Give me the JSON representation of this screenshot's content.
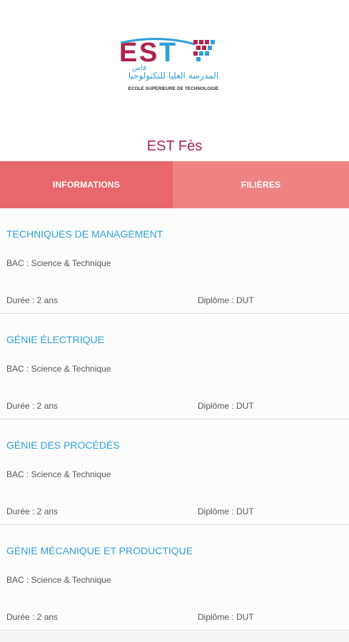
{
  "app": {
    "title": "EST Fès"
  },
  "logo": {
    "brand": "EST",
    "arabic": "المدرسة العليا للتكنولوجيا",
    "subtitle": "ECOLE SUPERIEURE DE TECHNOLOGIE",
    "city_arabic": "فاس",
    "colors": {
      "primary": "#b0224a",
      "accent": "#2e9fd8"
    }
  },
  "tabs": [
    {
      "label": "INFORMATIONS"
    },
    {
      "label": "FILIÈRES"
    }
  ],
  "filieres": [
    {
      "title": "TECHNIQUES DE MANAGEMENT",
      "bac": "BAC : Science & Technique",
      "duree": "Durée : 2 ans",
      "diplome": "Diplôme : DUT"
    },
    {
      "title": "GÉNIE ÉLECTRIQUE",
      "bac": "BAC : Science & Technique",
      "duree": "Durée : 2 ans",
      "diplome": "Diplôme : DUT"
    },
    {
      "title": "GÉNIE DES PROCÉDÉS",
      "bac": "BAC : Science & Technique",
      "duree": "Durée : 2 ans",
      "diplome": "Diplôme : DUT"
    },
    {
      "title": "GÉNIE MÉCANIQUE ET PRODUCTIQUE",
      "bac": "BAC : Science & Technique",
      "duree": "Durée : 2 ans",
      "diplome": "Diplôme : DUT"
    }
  ],
  "colors": {
    "tab_active": "#e8676a",
    "tab_inactive": "#ef8282",
    "title_color": "#2e9fd8",
    "app_title": "#b0224a"
  }
}
